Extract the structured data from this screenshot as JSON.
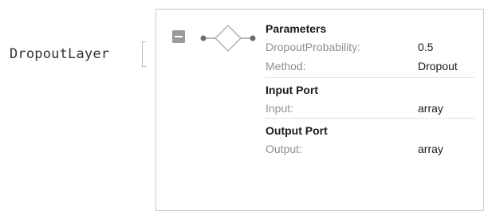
{
  "head": {
    "name": "DropoutLayer"
  },
  "icons": {
    "collapse": "collapse-minus-icon",
    "layer": "layer-diamond-icon"
  },
  "colors": {
    "panel_border": "#c8c8c8",
    "collapse_button": "#9a9a9a",
    "key_text": "#8f8f8f",
    "value_text": "#1a1a1a"
  },
  "sections": [
    {
      "title": "Parameters",
      "rows": [
        {
          "key": "DropoutProbability:",
          "value": "0.5"
        },
        {
          "key": "Method:",
          "value": "Dropout"
        }
      ]
    },
    {
      "title": "Input Port",
      "rows": [
        {
          "key": "Input:",
          "value": "array"
        }
      ]
    },
    {
      "title": "Output Port",
      "rows": [
        {
          "key": "Output:",
          "value": "array"
        }
      ]
    }
  ]
}
